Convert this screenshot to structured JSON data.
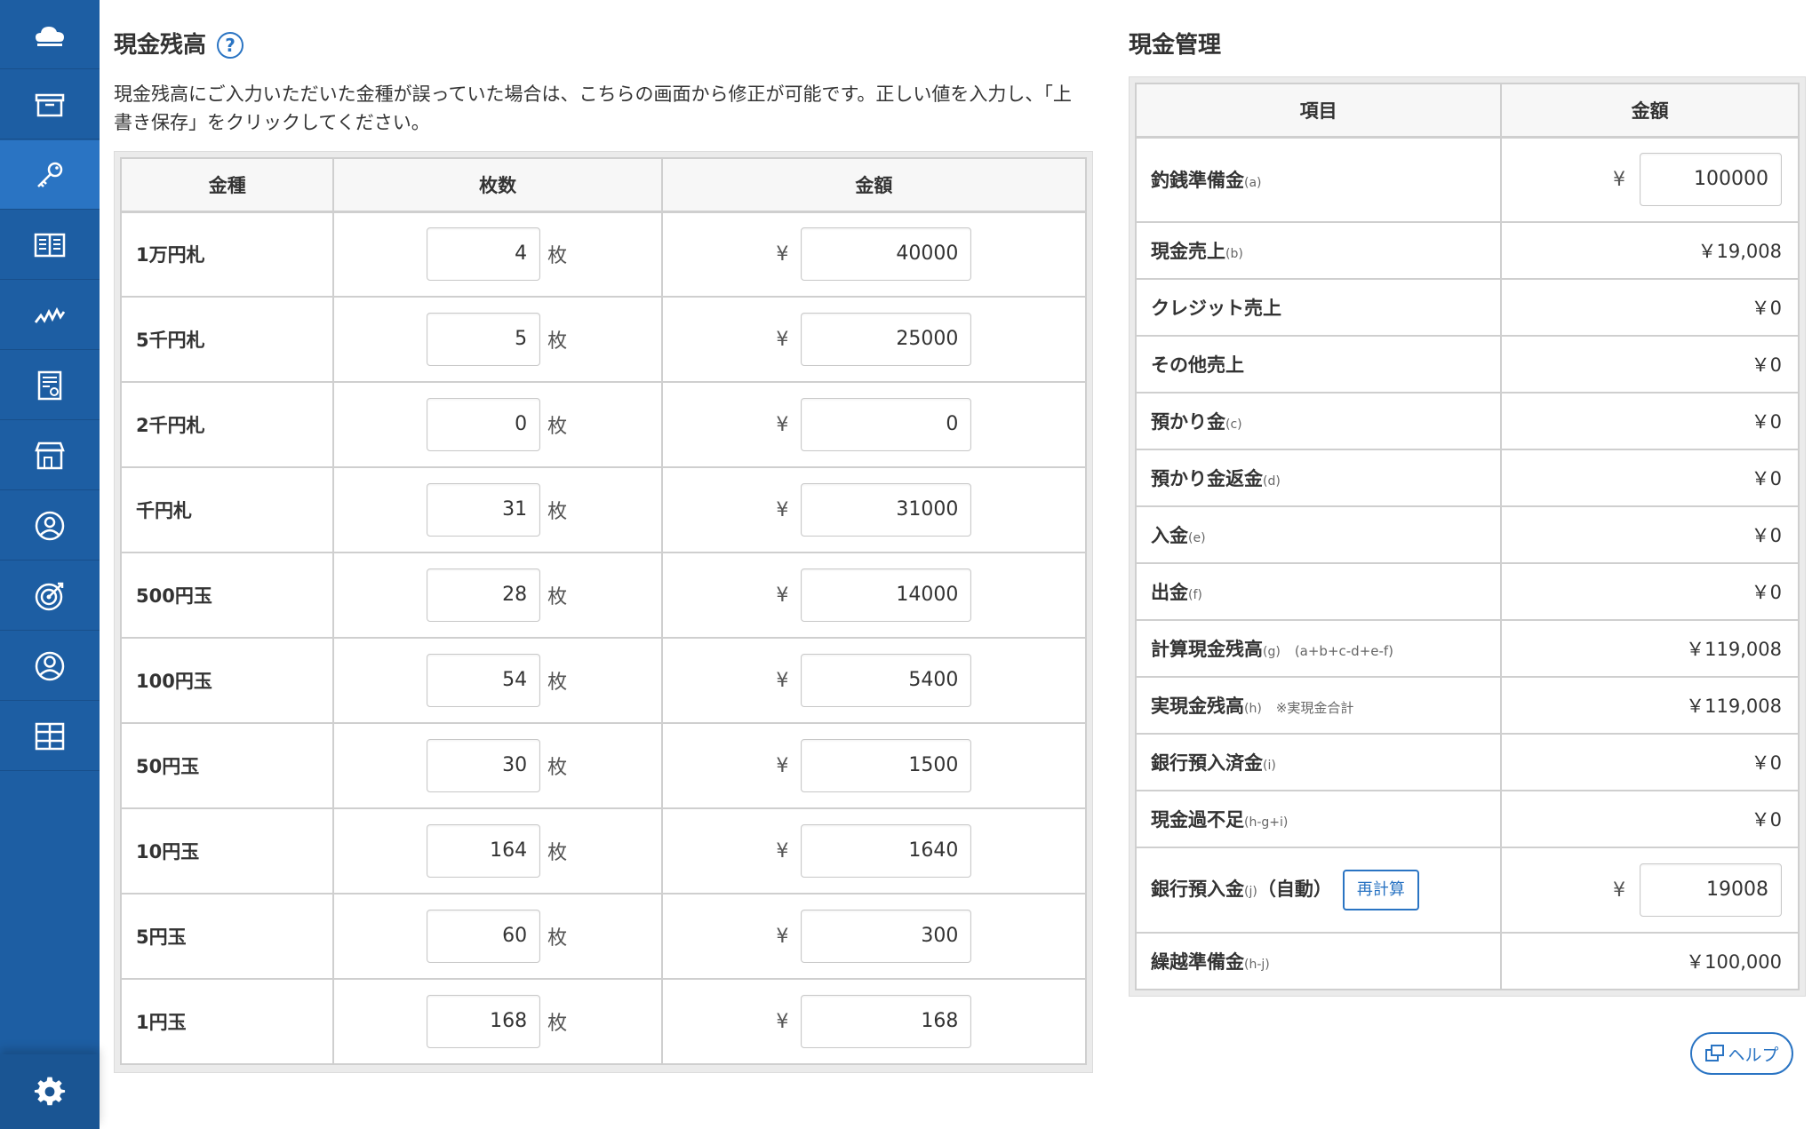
{
  "sidebar": {
    "items": [
      {
        "icon": "cloud-icon"
      },
      {
        "icon": "archive-box-icon"
      },
      {
        "icon": "key-icon"
      },
      {
        "icon": "book-icon"
      },
      {
        "icon": "chart-line-icon"
      },
      {
        "icon": "report-icon"
      },
      {
        "icon": "store-icon"
      },
      {
        "icon": "customer-icon"
      },
      {
        "icon": "target-icon"
      },
      {
        "icon": "user-icon"
      },
      {
        "icon": "apps-grid-icon"
      }
    ],
    "active_index": 2,
    "bottom_icon": "gear-icon"
  },
  "cash_balance": {
    "title": "現金残高",
    "help_icon": "?",
    "description": "現金残高にご入力いただいた金種が誤っていた場合は、こちらの画面から修正が可能です。正しい値を入力し、「上書き保存」をクリックしてください。",
    "headers": [
      "金種",
      "枚数",
      "金額"
    ],
    "unit": "枚",
    "yen": "¥",
    "rows": [
      {
        "label": "1万円札",
        "count": "4",
        "amount": "40000"
      },
      {
        "label": "5千円札",
        "count": "5",
        "amount": "25000"
      },
      {
        "label": "2千円札",
        "count": "0",
        "amount": "0"
      },
      {
        "label": "千円札",
        "count": "31",
        "amount": "31000"
      },
      {
        "label": "500円玉",
        "count": "28",
        "amount": "14000"
      },
      {
        "label": "100円玉",
        "count": "54",
        "amount": "5400"
      },
      {
        "label": "50円玉",
        "count": "30",
        "amount": "1500"
      },
      {
        "label": "10円玉",
        "count": "164",
        "amount": "1640"
      },
      {
        "label": "5円玉",
        "count": "60",
        "amount": "300"
      },
      {
        "label": "1円玉",
        "count": "168",
        "amount": "168"
      }
    ]
  },
  "cash_management": {
    "title": "現金管理",
    "headers": [
      "項目",
      "金額"
    ],
    "yen": "¥",
    "rows": [
      {
        "label": "釣銭準備金",
        "sub": "(a)",
        "input_value": "100000"
      },
      {
        "label": "現金売上",
        "sub": "(b)",
        "value": "￥19,008"
      },
      {
        "label": "クレジット売上",
        "sub": "",
        "value": "￥0"
      },
      {
        "label": "その他売上",
        "sub": "",
        "value": "￥0"
      },
      {
        "label": "預かり金",
        "sub": "(c)",
        "value": "￥0"
      },
      {
        "label": "預かり金返金",
        "sub": "(d)",
        "value": "￥0"
      },
      {
        "label": "入金",
        "sub": "(e)",
        "value": "￥0"
      },
      {
        "label": "出金",
        "sub": "(f)",
        "value": "￥0"
      },
      {
        "label": "計算現金残高",
        "sub": "(g)",
        "note": "(a+b+c-d+e-f)",
        "value": "￥119,008"
      },
      {
        "label": "実現金残高",
        "sub": "(h)",
        "note": "※実現金合計",
        "value": "￥119,008"
      },
      {
        "label": "銀行預入済金",
        "sub": "(i)",
        "value": "￥0"
      },
      {
        "label": "現金過不足",
        "sub": "(h-g+i)",
        "value": "￥0"
      },
      {
        "label": "銀行預入金",
        "sub": "(j)",
        "suffix": "（自動）",
        "button": "再計算",
        "input_value": "19008"
      },
      {
        "label": "繰越準備金",
        "sub": "(h-j)",
        "value": "￥100,000"
      }
    ]
  },
  "help_button": {
    "label": "ヘルプ",
    "icon": "external-window-icon"
  }
}
